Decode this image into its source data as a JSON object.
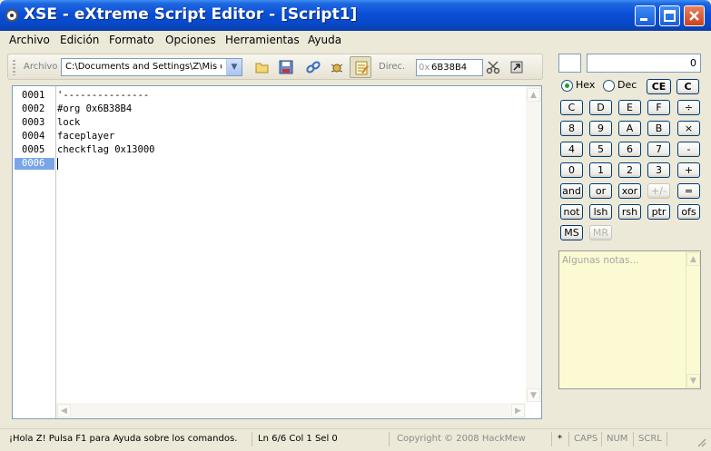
{
  "window": {
    "title": "XSE - eXtreme Script Editor - [Script1]",
    "minimize_icon": "minimize-icon",
    "maximize_icon": "maximize-icon",
    "close_icon": "close-icon"
  },
  "menu": [
    "Archivo",
    "Edición",
    "Formato",
    "Opciones",
    "Herramientas",
    "Ayuda"
  ],
  "toolbar": {
    "archivo_label": "Archivo",
    "path_value": "C:\\Documents and Settings\\Z\\Mis do",
    "direc_label": "Direc.",
    "address_prefix": "0x",
    "address_value": "6B38B4"
  },
  "editor": {
    "line_numbers": [
      "0001",
      "0002",
      "0003",
      "0004",
      "0005",
      "0006"
    ],
    "current_line": "0006",
    "lines": [
      "'---------------",
      "#org 0x6B38B4",
      "lock",
      "faceplayer",
      "checkflag 0x13000",
      ""
    ]
  },
  "calculator": {
    "display_value": "0",
    "hex_label": "Hex",
    "dec_label": "Dec",
    "mode": "Hex",
    "buttons": {
      "ce": "CE",
      "c_top": "C",
      "c": "C",
      "d": "D",
      "e": "E",
      "f": "F",
      "div": "÷",
      "n8": "8",
      "n9": "9",
      "a": "A",
      "b": "B",
      "mul": "×",
      "n4": "4",
      "n5": "5",
      "n6": "6",
      "n7": "7",
      "minus": "-",
      "n0": "0",
      "n1": "1",
      "n2": "2",
      "n3": "3",
      "plus": "+",
      "and": "and",
      "or": "or",
      "xor": "xor",
      "sign": "+/-",
      "eq": "=",
      "not": "not",
      "lsh": "lsh",
      "rsh": "rsh",
      "ptr": "ptr",
      "ofs": "ofs",
      "ms": "MS",
      "mr": "MR"
    },
    "notes_placeholder": "Algunas notas..."
  },
  "status": {
    "help": "¡Hola Z! Pulsa F1 para Ayuda sobre los comandos.",
    "position": "Ln 6/6  Col 1  Sel 0",
    "copyright": "Copyright © 2008 HackMew",
    "modified": "*",
    "caps": "CAPS",
    "num": "NUM",
    "scrl": "SCRL"
  },
  "colors": {
    "titlebar": "#0a4fd6",
    "current_line_highlight": "#7aa6e8",
    "notes_background": "#fbfad2"
  }
}
